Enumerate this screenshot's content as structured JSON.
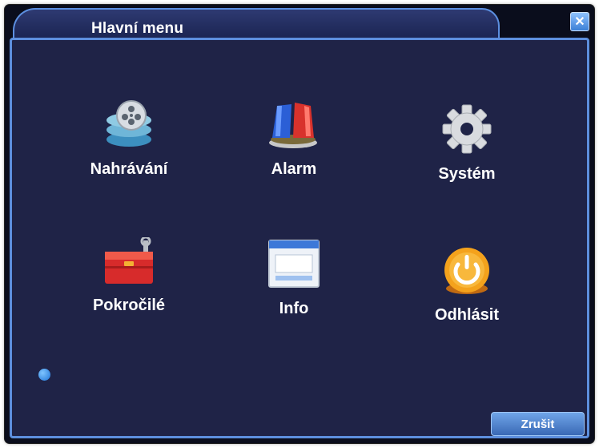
{
  "window": {
    "title": "Hlavní menu",
    "close_icon": "close-icon"
  },
  "menu": [
    {
      "id": "record",
      "label": "Nahrávání",
      "icon": "film-reel-icon"
    },
    {
      "id": "alarm",
      "label": "Alarm",
      "icon": "alarm-siren-icon"
    },
    {
      "id": "system",
      "label": "Systém",
      "icon": "gear-icon"
    },
    {
      "id": "advanced",
      "label": "Pokročilé",
      "icon": "toolbox-icon"
    },
    {
      "id": "info",
      "label": "Info",
      "icon": "info-window-icon"
    },
    {
      "id": "logout",
      "label": "Odhlásit",
      "icon": "power-icon"
    }
  ],
  "footer": {
    "status_icon": "info-icon",
    "cancel_label": "Zrušit"
  },
  "colors": {
    "panel_bg": "#1f2347",
    "border": "#5d8fde",
    "button": "#4a7cc7"
  }
}
